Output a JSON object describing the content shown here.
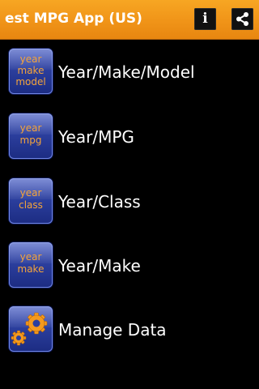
{
  "app": {
    "title": "est MPG App (US)",
    "accent_color": "#f09418",
    "background_color": "#000000"
  },
  "actions": {
    "info": {
      "icon": "info-icon",
      "glyph": "i"
    },
    "share": {
      "icon": "share-icon"
    }
  },
  "menu": {
    "items": [
      {
        "label": "Year/Make/Model",
        "icon_lines": [
          "year",
          "make",
          "model"
        ]
      },
      {
        "label": "Year/MPG",
        "icon_lines": [
          "year",
          "mpg"
        ]
      },
      {
        "label": "Year/Class",
        "icon_lines": [
          "year",
          "class"
        ]
      },
      {
        "label": "Year/Make",
        "icon_lines": [
          "year",
          "make"
        ]
      },
      {
        "label": "Manage Data",
        "icon": "gears-icon"
      }
    ]
  }
}
